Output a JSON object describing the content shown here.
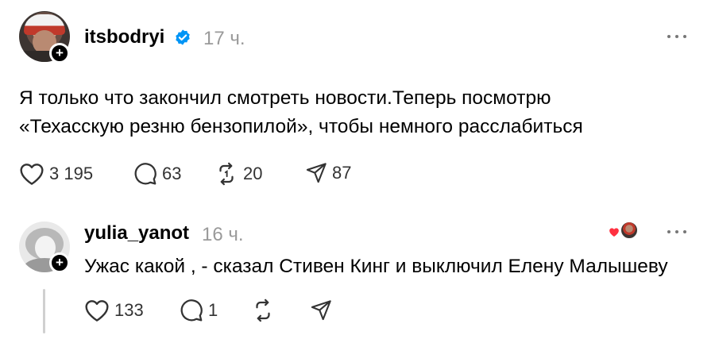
{
  "post": {
    "username": "itsbodryi",
    "time": "17 ч.",
    "text_lines": [
      "Я только что закончил смотреть новости.Теперь посмотрю",
      "«Техасскую резню бензопилой», чтобы немного расслабиться"
    ],
    "likes": "3 195",
    "comments": "63",
    "reposts": "20",
    "shares": "87"
  },
  "reply": {
    "username": "yulia_yanot",
    "time": "16 ч.",
    "text": "Ужас какой , - сказал Стивен Кинг и выключил Елену Малышеву",
    "likes": "133",
    "comments": "1"
  },
  "icons": {
    "verified": "verified-badge-icon",
    "follow": "plus-icon",
    "like": "heart-icon",
    "comment": "comment-bubble-icon",
    "repost": "repost-icon",
    "share": "send-icon",
    "more": "more-dots-icon"
  },
  "colors": {
    "verified_blue": "#0095f6",
    "liked_heart": "#ff3040",
    "muted_text": "#9a9a9a"
  }
}
